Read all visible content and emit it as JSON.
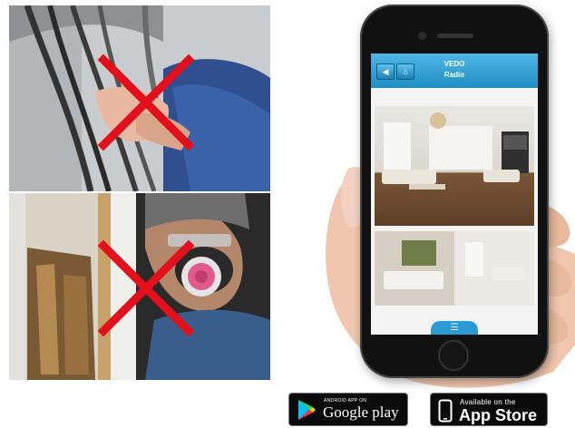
{
  "app": {
    "header_title_line1": "VEDO",
    "header_title_line2": "Radio",
    "back_icon": "back-arrow-icon",
    "home_icon": "home-icon",
    "menu_icon": "menu-icon"
  },
  "badges": {
    "google_small": "ANDROID APP ON",
    "google_big": "Google play",
    "apple_small": "Available on the",
    "apple_big": "App Store"
  },
  "colors": {
    "cross": "#e3101b",
    "app_header": "#2a9bd4",
    "badge_bg": "#0b0b0b"
  }
}
